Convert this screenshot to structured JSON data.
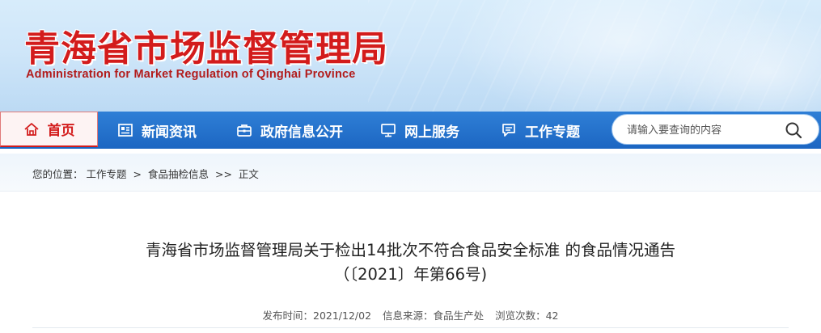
{
  "header": {
    "site_name_cn": "青海省市场监督管理局",
    "site_name_en": "Administration for Market Regulation of Qinghai Province"
  },
  "nav": {
    "home": "首页",
    "items": [
      {
        "label": "新闻资讯",
        "icon": "newspaper-icon"
      },
      {
        "label": "政府信息公开",
        "icon": "briefcase-icon"
      },
      {
        "label": "网上服务",
        "icon": "monitor-icon"
      },
      {
        "label": "工作专题",
        "icon": "chat-icon"
      }
    ],
    "search_placeholder": "请输入要查询的内容"
  },
  "breadcrumb": {
    "prefix": "您的位置：",
    "items": [
      "工作专题",
      "食品抽检信息",
      "正文"
    ],
    "sep1": ">",
    "sep2": ">>"
  },
  "article": {
    "title_line1": "青海省市场监督管理局关于检出14批次不符合食品安全标准 的食品情况通告",
    "title_line2": "（〔2021〕年第66号)",
    "publish_label": "发布时间：",
    "publish_date": "2021/12/02",
    "source_label": "信息来源：",
    "source": "食品生产处",
    "views_label": "浏览次数：",
    "views": "42"
  },
  "colors": {
    "brand_red": "#d31c1c",
    "nav_blue": "#1f6bc7",
    "banner_blue": "#cfe6f9"
  }
}
